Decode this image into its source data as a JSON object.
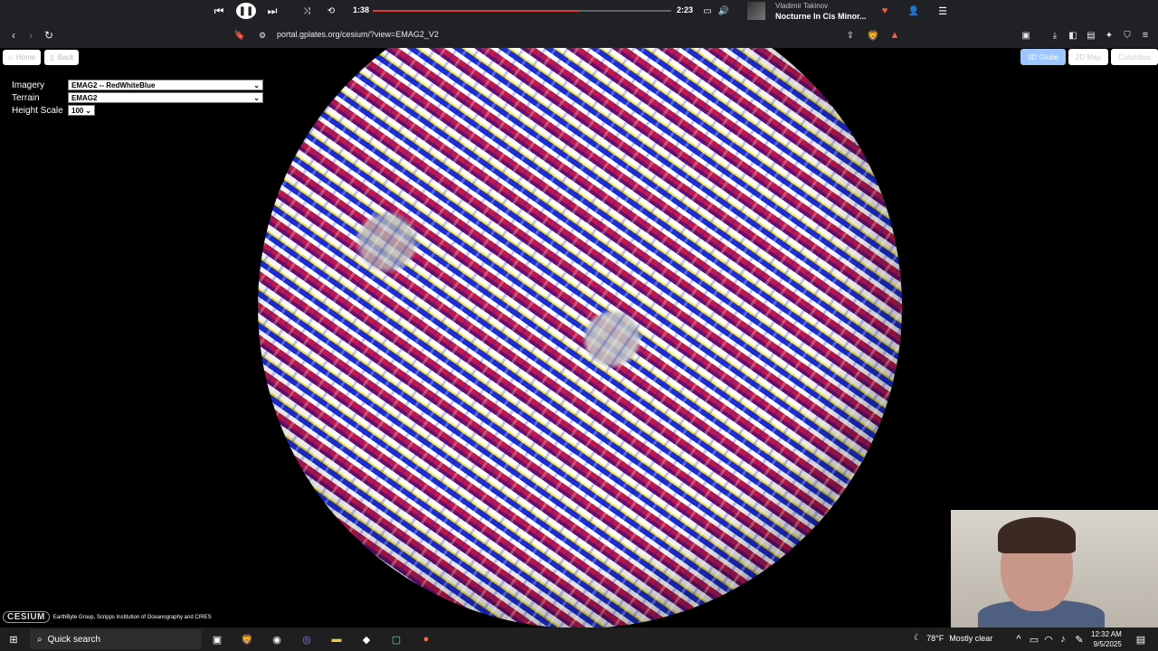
{
  "media": {
    "elapsed": "1:38",
    "duration": "2:23",
    "progress_fraction": 0.69,
    "artist": "Vladimir Takinov",
    "title": "Nocturne In Cis Minor..."
  },
  "browser": {
    "url": "portal.gplates.org/cesium/?view=EMAG2_V2"
  },
  "viewer": {
    "left_buttons": [
      "Home",
      "Back"
    ],
    "right_buttons": [
      "3D Globe",
      "2D Map",
      "Columbus"
    ],
    "active_view": "3D Globe",
    "imagery_label": "Imagery",
    "imagery_value": "EMAG2 -- RedWhiteBlue",
    "terrain_label": "Terrain",
    "terrain_value": "EMAG2",
    "height_label": "Height Scale",
    "height_value": "100",
    "logo_text": "CESIUM",
    "credit_text": "EarthByte Group, Scripps Institution of Oceanography and CIRES"
  },
  "taskbar": {
    "search_placeholder": "Quick search",
    "temperature": "78°F",
    "weather": "Mostly clear",
    "time": "12:32 AM",
    "date": "9/5/2025"
  },
  "colors": {
    "progress": "#e53935",
    "accent_button": "#9ec7ff"
  }
}
